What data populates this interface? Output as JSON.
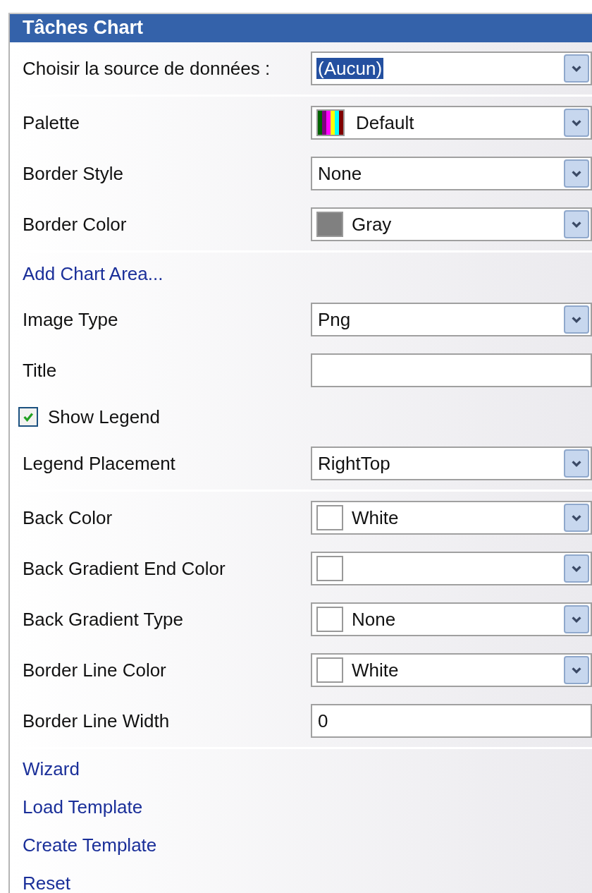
{
  "panel": {
    "title": "Tâches Chart"
  },
  "sections": [
    {
      "items": [
        {
          "kind": "dropdown",
          "label": "Choisir la source de données :",
          "value": "(Aucun)",
          "text_selected": true
        }
      ]
    },
    {
      "items": [
        {
          "kind": "dropdown",
          "label": "Palette",
          "value": "Default",
          "swatch": {
            "kind": "palette"
          }
        },
        {
          "kind": "dropdown",
          "label": "Border Style",
          "value": "None"
        },
        {
          "kind": "dropdown",
          "label": "Border Color",
          "value": "Gray",
          "swatch": {
            "kind": "color",
            "color": "#808080"
          }
        }
      ]
    },
    {
      "items": [
        {
          "kind": "link",
          "label": "Add Chart Area..."
        },
        {
          "kind": "dropdown",
          "label": "Image Type",
          "value": "Png"
        },
        {
          "kind": "text",
          "label": "Title"
        },
        {
          "kind": "checkbox",
          "label": "Show Legend",
          "checked": true
        },
        {
          "kind": "dropdown",
          "label": "Legend Placement",
          "value": "RightTop"
        }
      ]
    },
    {
      "items": [
        {
          "kind": "dropdown",
          "label": "Back Color",
          "value": "White",
          "swatch": {
            "kind": "color",
            "color": "#ffffff"
          }
        },
        {
          "kind": "dropdown",
          "label": "Back Gradient End Color",
          "swatch": {
            "kind": "color",
            "color": "#ffffff"
          }
        },
        {
          "kind": "dropdown",
          "label": "Back Gradient Type",
          "value": "None",
          "swatch": {
            "kind": "color",
            "color": "#ffffff"
          }
        },
        {
          "kind": "dropdown",
          "label": "Border Line Color",
          "value": "White",
          "swatch": {
            "kind": "color",
            "color": "#ffffff"
          }
        },
        {
          "kind": "text",
          "label": "Border Line Width",
          "value": "0"
        }
      ]
    },
    {
      "items": [
        {
          "kind": "link",
          "label": "Wizard"
        },
        {
          "kind": "link",
          "label": "Load Template"
        },
        {
          "kind": "link",
          "label": "Create Template"
        },
        {
          "kind": "link",
          "label": "Reset"
        }
      ]
    }
  ]
}
